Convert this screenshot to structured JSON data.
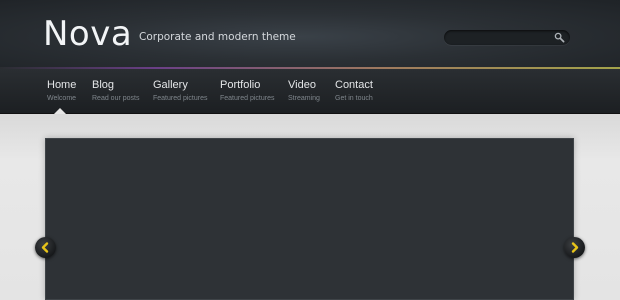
{
  "header": {
    "logo": "Nova",
    "tagline": "Corporate and modern theme",
    "search_placeholder": ""
  },
  "nav": {
    "items": [
      {
        "label": "Home",
        "sub": "Welcome",
        "active": true
      },
      {
        "label": "Blog",
        "sub": "Read our posts"
      },
      {
        "label": "Gallery",
        "sub": "Featured pictures"
      },
      {
        "label": "Portfolio",
        "sub": "Featured pictures"
      },
      {
        "label": "Video",
        "sub": "Streaming"
      },
      {
        "label": "Contact",
        "sub": "Get in touch"
      }
    ]
  },
  "slider": {
    "prev_icon": "chevron-left-icon",
    "next_icon": "chevron-right-icon",
    "arrow_color": "#e8c419"
  },
  "colors": {
    "header_bg": "#2b3035",
    "accent_purple": "#6a3f86",
    "accent_yellow": "#a3a34a",
    "slider_bg": "#2e3236"
  }
}
